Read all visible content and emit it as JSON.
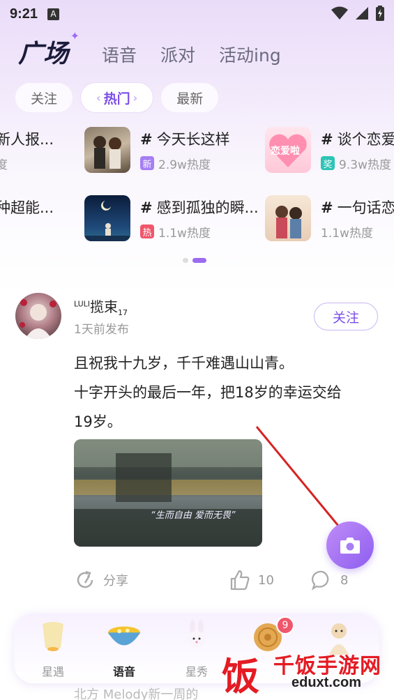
{
  "status_bar": {
    "time": "9:21",
    "notification_glyph": "A"
  },
  "header": {
    "tabs": [
      {
        "label": "广场",
        "active": true
      },
      {
        "label": "语音"
      },
      {
        "label": "派对"
      },
      {
        "label": "活动ing"
      }
    ]
  },
  "sub_tabs": [
    {
      "label": "关注"
    },
    {
      "label": "热门",
      "active": true
    },
    {
      "label": "最新"
    }
  ],
  "topics": [
    {
      "title": "新人报...",
      "meta": "度",
      "partial": true
    },
    {
      "title": "今天长这样",
      "tag": "新",
      "tag_color": "#a57ef4",
      "heat": "2.9w热度"
    },
    {
      "title": "谈个恋爱",
      "tag": "奖",
      "tag_color": "#2ec4b6",
      "heat": "9.3w热度"
    },
    {
      "title": "种超能...",
      "meta": "",
      "partial": true
    },
    {
      "title": "感到孤独的瞬...",
      "tag": "热",
      "tag_color": "#f0566b",
      "heat": "1.1w热度"
    },
    {
      "title": "一句话恋",
      "heat": "1.1w热度"
    }
  ],
  "topic_thumb_text": "恋爱啦",
  "post": {
    "username": "揽束",
    "username_prefix": "LULI",
    "username_suffix": "17",
    "time": "1天前发布",
    "follow_label": "关注",
    "text_line1": "且祝我十九岁，千千难遇山山青。",
    "text_line2": "十字开头的最后一年，把18岁的幸运交给",
    "text_line3": "19岁。",
    "image_caption": "“生而自由 爱而无畏”",
    "share_label": "分享",
    "like_count": "10",
    "comment_count": "8"
  },
  "bottom_nav": {
    "items": [
      {
        "label": "星遇"
      },
      {
        "label": "语音",
        "active": true
      },
      {
        "label": "星秀"
      },
      {
        "label": "",
        "badge": "9"
      },
      {
        "label": ""
      }
    ]
  },
  "peek_text": "北方 Melody新一周的",
  "watermark": {
    "brand": "千饭手游网",
    "url": "eduxt.com",
    "logo_glyph": "饭"
  },
  "colors": {
    "accent": "#8d5ef0",
    "badge": "#f0566b",
    "watermark": "#e41b23"
  }
}
